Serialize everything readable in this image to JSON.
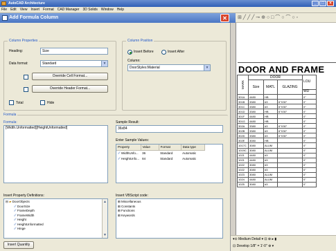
{
  "app": {
    "title": "AutoCAD Architecture",
    "menu": [
      "File",
      "Edit",
      "View",
      "Insert",
      "Format",
      "CAD Manager",
      "3D Solids",
      "Window",
      "Help"
    ]
  },
  "dialog": {
    "title": "Add Formula Column",
    "column_properties": {
      "legend": "Column Properties",
      "heading_label": "Heading:",
      "heading_value": "Size",
      "data_format_label": "Data format:",
      "data_format_value": "Standard",
      "override_cell_format": "Override Cell Format...",
      "override_header_format": "Override Header Format...",
      "total_label": "Total",
      "hide_label": "Hide"
    },
    "column_position": {
      "legend": "Column Position",
      "insert_before": "Insert Before",
      "insert_after": "Insert After",
      "column_label": "Column:",
      "column_value": "DoorStyles:Material"
    },
    "formula": {
      "legend": "Formula",
      "label": "Formula:",
      "value": "[Width.Unformatted][HeightUnformatted]"
    },
    "sample_result": {
      "label": "Sample Result:",
      "value": "36x84",
      "enter_label": "Enter Sample Values:",
      "headers": [
        "Property",
        "Value",
        "Format",
        "Data type"
      ],
      "rows": [
        [
          "WidthUnfo...",
          "36",
          "Standard",
          "Automatic"
        ],
        [
          "HeightUnfo...",
          "84",
          "Standard",
          "Automatic"
        ]
      ]
    },
    "insert_property": {
      "label": "Insert Property Definitions:",
      "items": [
        "DoorObjects",
        "DoorSize",
        "FrameDepth",
        "FrameWidth",
        "Height",
        "HeightUnformatted",
        "Hinge"
      ]
    },
    "insert_vbscript": {
      "label": "Insert VBScript code:",
      "items": [
        "Miscellaneous",
        "Constants",
        "Functions",
        "Keywords"
      ]
    },
    "insert_quantity_button": "Insert Quantity"
  },
  "drawing": {
    "title": "DOOR AND FRAME",
    "subheader": "DOOR",
    "col_mark": "MARK",
    "col_size": "Size",
    "col_matl": "MATL",
    "col_glazing": "GLAZING",
    "col_lou": "LOU",
    "col_wd": "WD",
    "rows": [
      [
        "301A",
        "4480",
        "HB",
        "",
        "0\""
      ],
      [
        "301B",
        "3380",
        "#3",
        "6\"X30\"",
        "0\""
      ],
      [
        "301C",
        "3380",
        "#3",
        "6\"X30\"",
        "0\""
      ],
      [
        "301D",
        "3380",
        "HB",
        "6\"X30\"",
        "0\""
      ],
      [
        "301F",
        "4480",
        "HB",
        "",
        "0\""
      ],
      [
        "301G",
        "4480",
        "HB",
        "",
        "0\""
      ],
      [
        "302A",
        "3380",
        "#3",
        "6\"X30\"",
        "0\""
      ],
      [
        "302B",
        "3380",
        "#3",
        "6\"X30\"",
        "0\""
      ],
      [
        "302D",
        "3380",
        "#3",
        "6\"X30\"",
        "0\""
      ],
      [
        "302E",
        "3080",
        "HB",
        "",
        "0\""
      ],
      [
        "1017C",
        "3080",
        "ALUM",
        "",
        "0\""
      ],
      [
        "1019C",
        "3080",
        "ALUM",
        "",
        "0\""
      ],
      [
        "1021",
        "4480",
        "#3",
        "",
        "0\""
      ],
      [
        "1021",
        "4480",
        "#3",
        "",
        "0\""
      ],
      [
        "1022",
        "3080",
        "#3",
        "",
        "0\""
      ],
      [
        "1022",
        "3080",
        "#3",
        "",
        "0\""
      ],
      [
        "1023",
        "3080",
        "ALUM",
        "",
        "0\""
      ],
      [
        "1024",
        "4480",
        "ALUM",
        "",
        "0\""
      ],
      [
        "1025",
        "3080",
        "#3",
        "",
        "0\""
      ]
    ],
    "status": {
      "line1": "Medium Detail",
      "line2": "Develop 1/8\" = 1'-0\""
    }
  }
}
